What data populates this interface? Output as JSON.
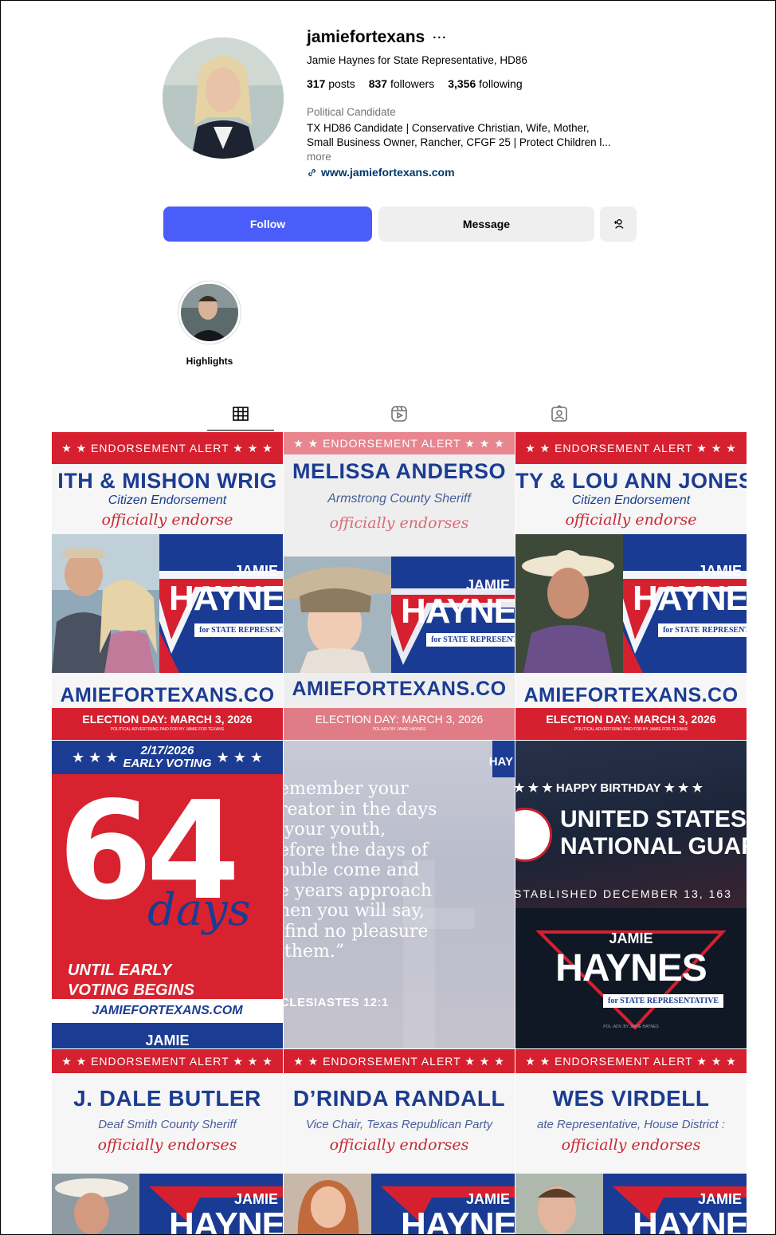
{
  "profile": {
    "username": "jamiefortexans",
    "more_options": "···",
    "full_name": "Jamie Haynes for State Representative, HD86",
    "stats": {
      "posts_count": "317",
      "posts_label": "posts",
      "followers_count": "837",
      "followers_label": "followers",
      "following_count": "3,356",
      "following_label": "following"
    },
    "category": "Political Candidate",
    "bio_line1": "TX HD86 Candidate | Conservative Christian, Wife, Mother,",
    "bio_line2": "Small Business Owner, Rancher, CFGF 25 | Protect Children l...",
    "more_label": "more",
    "website": "www.jamiefortexans.com"
  },
  "actions": {
    "follow_label": "Follow",
    "message_label": "Message",
    "add_user_icon": "add-user-icon"
  },
  "highlights": [
    {
      "label": "Highlights"
    }
  ],
  "tabs": [
    {
      "icon": "grid-icon",
      "active": true
    },
    {
      "icon": "reels-icon",
      "active": false
    },
    {
      "icon": "tagged-icon",
      "active": false
    }
  ],
  "posts": {
    "p1": {
      "alert": "★ ★ ENDORSEMENT ALERT ★ ★ ★",
      "name": "ITH & MISHON WRIG",
      "role": "Citizen Endorsement",
      "script": "officially endorse",
      "jamie": "JAMIE",
      "haynes": "HAYNE",
      "forstate": "for STATE REPRESENT",
      "url": "AMIEFORTEXANS.CO",
      "election": "ELECTION DAY: MARCH 3, 2026",
      "paid": "POLITICAL ADVERTISING PAID FOR BY JAMIE FOR TEXANS"
    },
    "p2": {
      "alert": "★ ★ ENDORSEMENT ALERT ★ ★ ★",
      "name": "MELISSA ANDERSO",
      "role": "Armstrong County Sheriff",
      "script": "officially endorses",
      "jamie": "JAMIE",
      "haynes": "HAYNE",
      "forstate": "for STATE REPRESENT",
      "url": "AMIEFORTEXANS.CO",
      "election": "ELECTION DAY: MARCH 3, 2026",
      "paid": "POL ADV BY JAMIE HAYNES"
    },
    "p3": {
      "alert": "★ ★ ENDORSEMENT ALERT ★ ★ ★",
      "name": "TY & LOU ANN JONES",
      "role": "Citizen Endorsement",
      "script": "officially endorse",
      "jamie": "JAMIE",
      "haynes": "HAYNE",
      "forstate": "for STATE REPRESENT",
      "url": "AMIEFORTEXANS.CO",
      "election": "ELECTION DAY: MARCH 3, 2026",
      "paid": "POLITICAL ADVERTISING PAID FOR BY JAMIE FOR TEXANS"
    },
    "p4": {
      "stars": "★ ★ ★",
      "date": "2/17/2026",
      "early": "EARLY VOTING",
      "number": "64",
      "days": "days",
      "until1": "UNTIL EARLY",
      "until2": "VOTING BEGINS",
      "url": "JAMIEFORTEXANS.COM",
      "cut": "JAMIE"
    },
    "p5": {
      "verse": "emember your\nreator in the days\n your youth,\nefore the days of\nouble come and\ne years approach\nhen you will say,\n find no pleasure\n them.”",
      "ref": "CLESIASTES 12:1",
      "logo": "HAY"
    },
    "p6": {
      "birthday": "★ ★ ★  HAPPY BIRTHDAY  ★ ★ ★",
      "us1": "UNITED STATES",
      "us2": "NATIONAL GUARI",
      "established": "STABLISHED DECEMBER 13, 163",
      "jamie": "JAMIE",
      "haynes": "HAYNES",
      "forstate": "for STATE REPRESENTATIVE",
      "pol": "POL. ADV. BY JAMIE HAYNES"
    },
    "p7": {
      "alert": "★ ★ ENDORSEMENT ALERT ★ ★ ★",
      "name": "J. DALE BUTLER",
      "role": "Deaf Smith County Sheriff",
      "script": "officially endorses",
      "jamie": "JAMIE",
      "haynes": "HAYNE"
    },
    "p8": {
      "alert": "★ ★ ENDORSEMENT ALERT ★ ★ ★",
      "name": "D’RINDA RANDALL",
      "role": "Vice Chair, Texas Republican Party",
      "script": "officially endorses",
      "jamie": "JAMIE",
      "haynes": "HAYNE"
    },
    "p9": {
      "alert": "★ ★ ENDORSEMENT ALERT ★ ★ ★",
      "name": "WES VIRDELL",
      "role": "ate Representative, House District :",
      "script": "officially endorses",
      "jamie": "JAMIE",
      "haynes": "HAYNE"
    }
  },
  "colors": {
    "follow_blue": "#4a5df9",
    "campaign_red": "#d6202f",
    "campaign_blue": "#1b3c92"
  }
}
